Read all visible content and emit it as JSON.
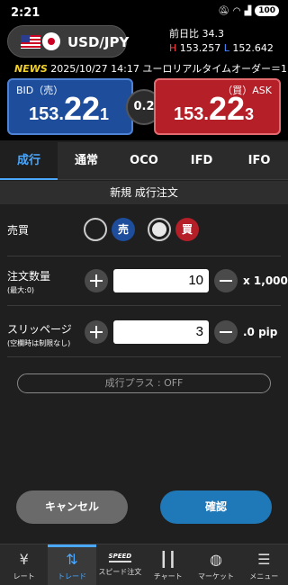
{
  "status_bar": {
    "time": "2:21",
    "battery": "100"
  },
  "header": {
    "pair": "USD/JPY",
    "prev_day_label": "前日比",
    "prev_day_value": "34.3",
    "high_label": "H",
    "high_value": "153.257",
    "low_label": "L",
    "low_value": "152.642"
  },
  "news": {
    "tag": "NEWS",
    "text": "2025/10/27 14:17 ユーロリアルタイムオーダー＝1."
  },
  "quotes": {
    "bid_label": "BID（売）",
    "bid_small": "153.",
    "bid_big": "22",
    "bid_pip": "1",
    "ask_label": "（買）ASK",
    "ask_small": "153.",
    "ask_big": "22",
    "ask_pip": "3",
    "spread": "0.2"
  },
  "tabs": [
    "成行",
    "通常",
    "OCO",
    "IFD",
    "IFO"
  ],
  "subtitle": "新規 成行注文",
  "form": {
    "side_label": "売買",
    "sell_label": "売",
    "buy_label": "買",
    "qty_label": "注文数量",
    "qty_sub": "(最大:0)",
    "qty_value": "10",
    "qty_unit": "x 1,000",
    "slip_label": "スリッページ",
    "slip_sub": "(空欄時は制限なし)",
    "slip_value": "3",
    "slip_unit": ".0 pip",
    "plus_label": "成行プラス : OFF"
  },
  "actions": {
    "cancel": "キャンセル",
    "confirm": "確認"
  },
  "nav": {
    "rate": "レート",
    "trade": "トレード",
    "speed_icon": "SPEED",
    "speed": "スピード注文",
    "chart": "チャート",
    "market": "マーケット",
    "menu": "メニュー"
  },
  "colors": {
    "bid": "#1d4d9b",
    "ask": "#b51f28",
    "accent": "#4aa8ff",
    "high": "#ff4646",
    "low": "#4d8cff",
    "news_tag": "#f2d12b"
  }
}
